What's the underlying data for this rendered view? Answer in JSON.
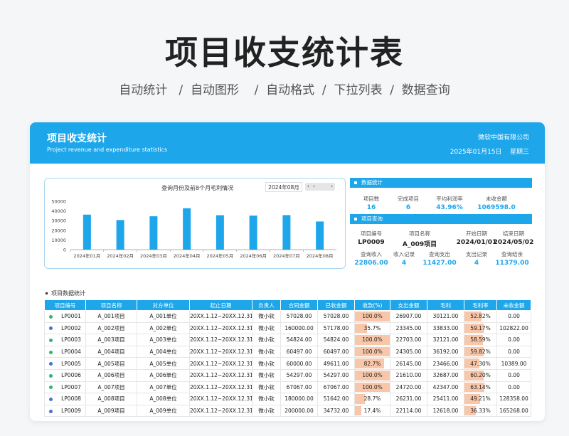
{
  "hero": {
    "title": "项目收支统计表",
    "subtitle": "自动统计   /  自动图形    /  自动格式  /  下拉列表  /  数据查询"
  },
  "banner": {
    "title": "项目收支统计",
    "subtitle": "Project revenue and expenditure statistics",
    "company": "微软中国有限公司",
    "date": "2025年01月15日",
    "weekday": "星期三"
  },
  "chart_panel": {
    "title": "查询月份及前8个月毛利情况",
    "selected_month": "2024年08月",
    "scroll_left": "‹",
    "scroll_right": "›",
    "scroll_mid": "‹"
  },
  "chart_data": {
    "type": "bar",
    "categories": [
      "2024年01月",
      "2024年02月",
      "2024年03月",
      "2024年04月",
      "2024年05月",
      "2024年06月",
      "2024年07月",
      "2024年08月"
    ],
    "values": [
      36200,
      30600,
      34500,
      42800,
      35600,
      35200,
      35700,
      29100
    ],
    "yticks": [
      "0",
      "10000",
      "20000",
      "30000",
      "40000",
      "50000"
    ],
    "ylim": [
      0,
      50000
    ],
    "title": "查询月份及前8个月毛利情况",
    "grid": false,
    "bar_color": "#1da6ea"
  },
  "stats": {
    "header": "数据统计",
    "labels": [
      "项目数",
      "完成项目",
      "平均利润率",
      "未收金额"
    ],
    "values": [
      "16",
      "6",
      "43.96%",
      "1069598.0"
    ]
  },
  "query": {
    "header": "项目查询",
    "row1_labels": [
      "项目编号",
      "项目名称",
      "开始日期",
      "结束日期"
    ],
    "row1_values": [
      "LP0009",
      "A_009项目",
      "2024/01/01",
      "2024/05/02"
    ],
    "row2_labels": [
      "查询收入",
      "收入记录",
      "查询支出",
      "支出记录",
      "查询结余"
    ],
    "row2_values": [
      "22806.00",
      "4",
      "11427.00",
      "4",
      "11379.00"
    ]
  },
  "table": {
    "title": "项目数据统计",
    "columns": [
      "项目编号",
      "项目名称",
      "对方单位",
      "起止日期",
      "负责人",
      "合同金额",
      "已收金额",
      "收款(%)",
      "支出金额",
      "毛利",
      "毛利率",
      "未收金额"
    ],
    "rows": [
      {
        "id": "LP0001",
        "name": "A_001项目",
        "unit": "A_001单位",
        "period": "20XX.1.12~20XX.12.31",
        "owner": "微小软",
        "contract": "57028.00",
        "received": "57028.00",
        "pct": "100.0%",
        "pct_value": 100.0,
        "expense": "26907.00",
        "profit": "30121.00",
        "margin": "52.82%",
        "margin_value": 52.82,
        "unpaid": "0.00",
        "dot": "#2bb673"
      },
      {
        "id": "LP0002",
        "name": "A_002项目",
        "unit": "A_002单位",
        "period": "20XX.1.12~20XX.12.31",
        "owner": "微小软",
        "contract": "160000.00",
        "received": "57178.00",
        "pct": "35.7%",
        "pct_value": 35.7,
        "expense": "23345.00",
        "profit": "33833.00",
        "margin": "59.17%",
        "margin_value": 59.17,
        "unpaid": "102822.00",
        "dot": "#4a6fd8"
      },
      {
        "id": "LP0003",
        "name": "A_003项目",
        "unit": "A_003单位",
        "period": "20XX.1.12~20XX.12.31",
        "owner": "微小软",
        "contract": "54824.00",
        "received": "54824.00",
        "pct": "100.0%",
        "pct_value": 100.0,
        "expense": "22703.00",
        "profit": "32121.00",
        "margin": "58.59%",
        "margin_value": 58.59,
        "unpaid": "0.00",
        "dot": "#2bb673"
      },
      {
        "id": "LP0004",
        "name": "A_004项目",
        "unit": "A_004单位",
        "period": "20XX.1.12~20XX.12.31",
        "owner": "微小软",
        "contract": "60497.00",
        "received": "60497.00",
        "pct": "100.0%",
        "pct_value": 100.0,
        "expense": "24305.00",
        "profit": "36192.00",
        "margin": "59.82%",
        "margin_value": 59.82,
        "unpaid": "0.00",
        "dot": "#2bb673"
      },
      {
        "id": "LP0005",
        "name": "A_005项目",
        "unit": "A_005单位",
        "period": "20XX.1.12~20XX.12.31",
        "owner": "微小软",
        "contract": "60000.00",
        "received": "49611.00",
        "pct": "82.7%",
        "pct_value": 82.7,
        "expense": "26145.00",
        "profit": "23466.00",
        "margin": "47.30%",
        "margin_value": 47.3,
        "unpaid": "10389.00",
        "dot": "#4a6fd8"
      },
      {
        "id": "LP0006",
        "name": "A_006项目",
        "unit": "A_006单位",
        "period": "20XX.1.12~20XX.12.31",
        "owner": "微小软",
        "contract": "54297.00",
        "received": "54297.00",
        "pct": "100.0%",
        "pct_value": 100.0,
        "expense": "21610.00",
        "profit": "32687.00",
        "margin": "60.20%",
        "margin_value": 60.2,
        "unpaid": "0.00",
        "dot": "#2bb673"
      },
      {
        "id": "LP0007",
        "name": "A_007项目",
        "unit": "A_007单位",
        "period": "20XX.1.12~20XX.12.31",
        "owner": "微小软",
        "contract": "67067.00",
        "received": "67067.00",
        "pct": "100.0%",
        "pct_value": 100.0,
        "expense": "24720.00",
        "profit": "42347.00",
        "margin": "63.14%",
        "margin_value": 63.14,
        "unpaid": "0.00",
        "dot": "#2bb673"
      },
      {
        "id": "LP0008",
        "name": "A_008项目",
        "unit": "A_008单位",
        "period": "20XX.1.12~20XX.12.31",
        "owner": "微小软",
        "contract": "180000.00",
        "received": "51642.00",
        "pct": "28.7%",
        "pct_value": 28.7,
        "expense": "26231.00",
        "profit": "25411.00",
        "margin": "49.21%",
        "margin_value": 49.21,
        "unpaid": "128358.00",
        "dot": "#4a6fd8"
      },
      {
        "id": "LP0009",
        "name": "A_009项目",
        "unit": "A_009单位",
        "period": "20XX.1.12~20XX.12.31",
        "owner": "微小软",
        "contract": "200000.00",
        "received": "34732.00",
        "pct": "17.4%",
        "pct_value": 17.4,
        "expense": "22114.00",
        "profit": "12618.00",
        "margin": "36.33%",
        "margin_value": 36.33,
        "unpaid": "165268.00",
        "dot": "#4a6fd8"
      }
    ]
  },
  "colors": {
    "accent": "#1da6ea",
    "bar_fill": "#f8c7a9",
    "complete_dot": "#2bb673",
    "open_dot": "#4a6fd8"
  }
}
